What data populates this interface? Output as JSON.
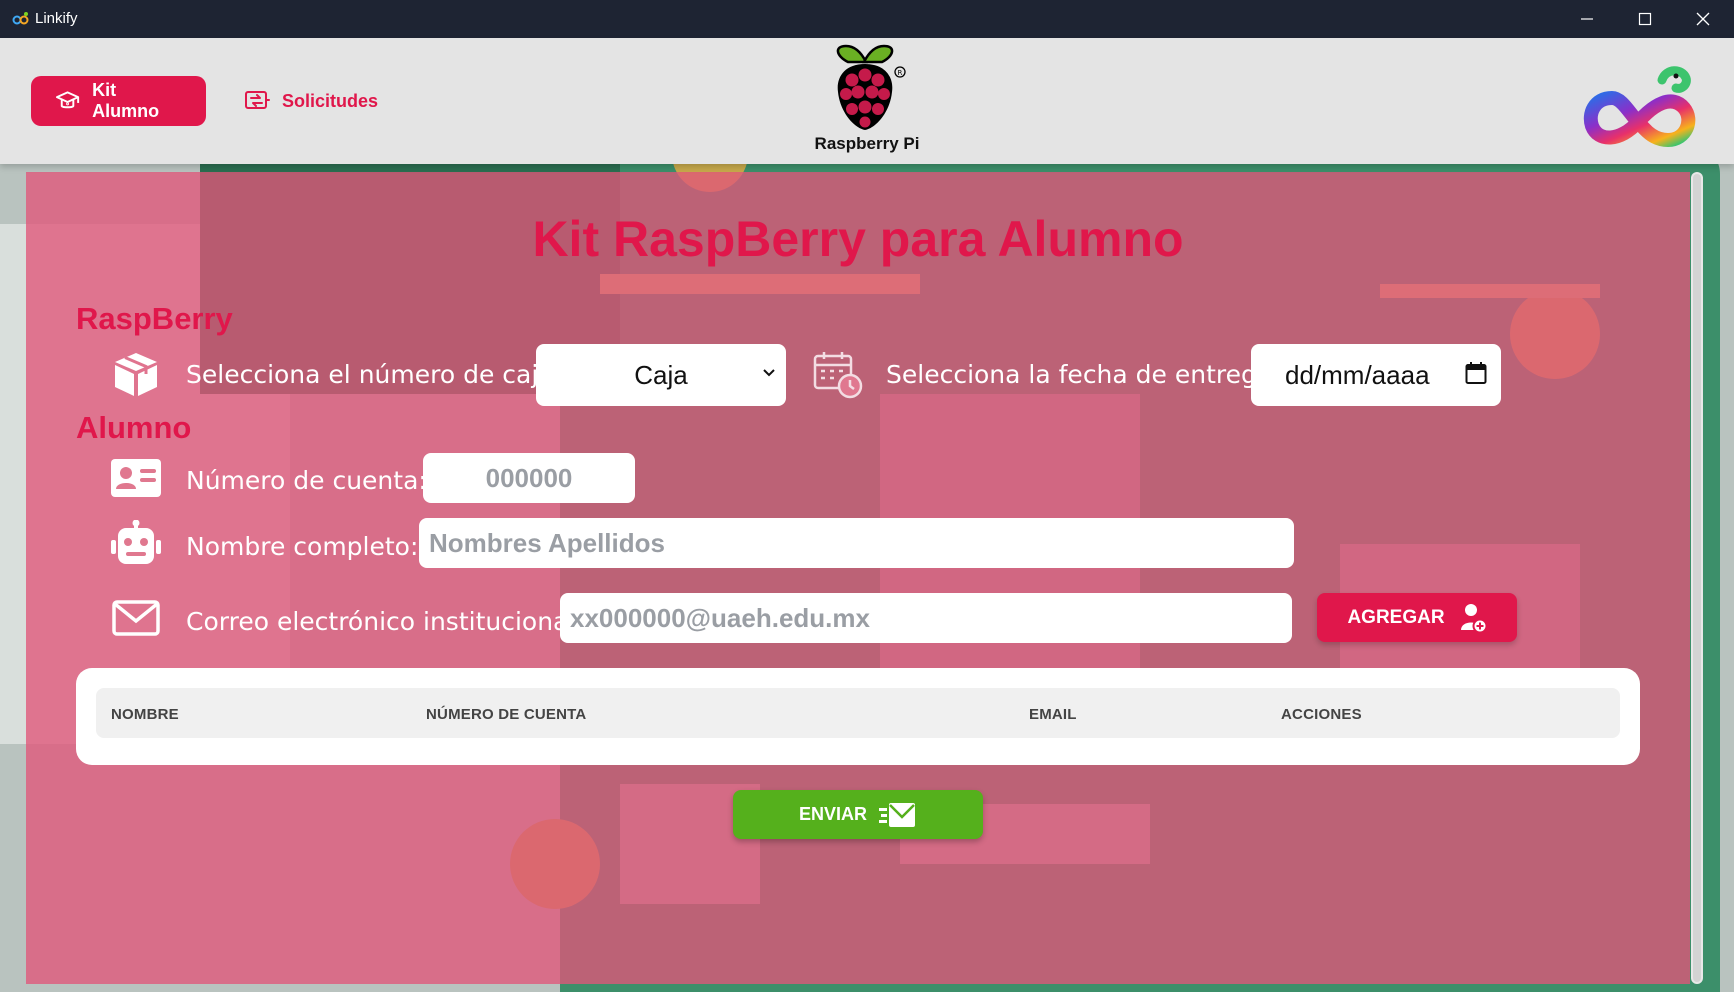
{
  "window": {
    "title": "Linkify"
  },
  "header": {
    "nav": [
      {
        "label": "Kit Alumno",
        "icon": "graduation-cap-icon"
      },
      {
        "label": "Solicitudes",
        "icon": "transfer-icon"
      }
    ],
    "center_logo_label": "Raspberry Pi"
  },
  "main": {
    "title": "Kit RaspBerry para Alumno",
    "raspberry_section": {
      "heading": "RaspBerry",
      "box_label": "Selecciona el número de caja:",
      "box_select_value": "Caja",
      "date_label": "Selecciona la fecha de entrega:",
      "date_placeholder": "dd/mm/aaaa"
    },
    "student_section": {
      "heading": "Alumno",
      "account_label": "Número de cuenta:",
      "account_placeholder": "000000",
      "name_label": "Nombre completo:",
      "name_placeholder": "Nombres Apellidos",
      "email_label": "Correo electrónico institucional:",
      "email_placeholder": "xx000000@uaeh.edu.mx",
      "add_button": "AGREGAR"
    },
    "table": {
      "columns": [
        "NOMBRE",
        "NÚMERO DE CUENTA",
        "EMAIL",
        "ACCIONES"
      ],
      "rows": []
    },
    "send_button": "ENVIAR"
  },
  "colors": {
    "accent": "#e0174b",
    "send": "#55b01c",
    "titlebar": "#1e2433"
  }
}
